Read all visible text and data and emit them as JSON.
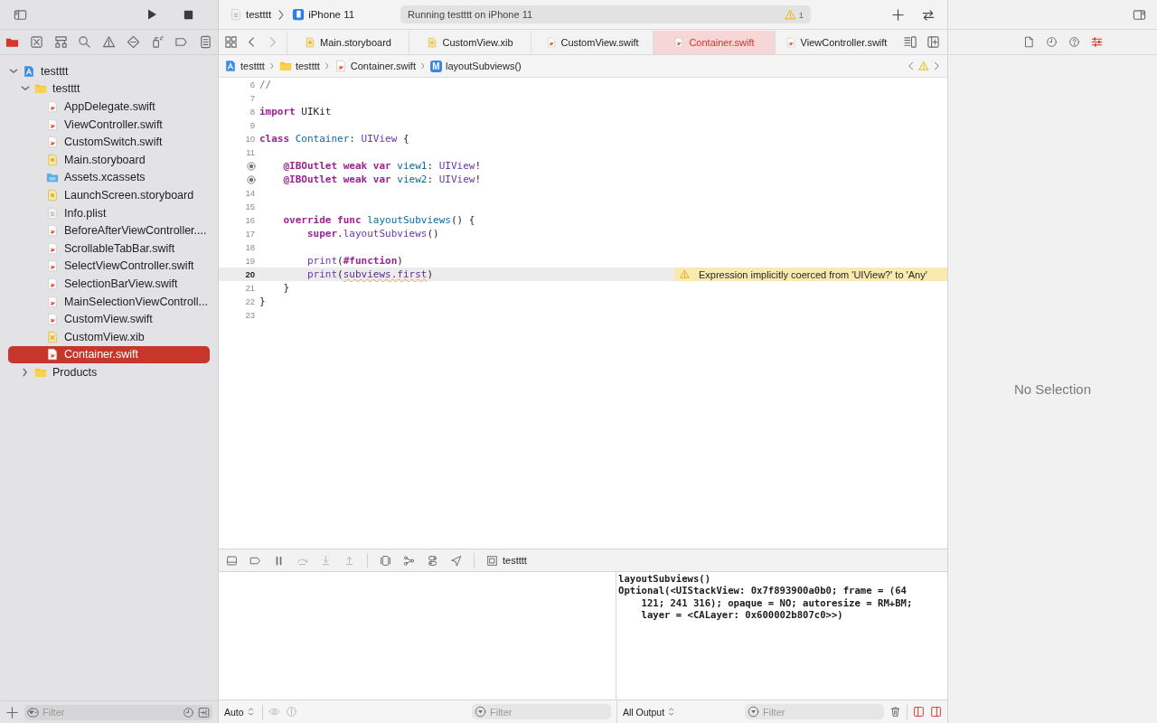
{
  "toolbar": {
    "scheme": "testttt",
    "device": "iPhone 11",
    "activity": "Running testttt on iPhone 11",
    "warning_count": "1"
  },
  "navigator": {
    "tree": [
      {
        "name": "testttt",
        "kind": "project",
        "expanded": true,
        "selected": false,
        "children": [
          {
            "name": "testttt",
            "kind": "folder",
            "expanded": true,
            "selected": false,
            "children": [
              {
                "name": "AppDelegate.swift",
                "kind": "swift",
                "selected": false
              },
              {
                "name": "ViewController.swift",
                "kind": "swift",
                "selected": false
              },
              {
                "name": "CustomSwitch.swift",
                "kind": "swift",
                "selected": false
              },
              {
                "name": "Main.storyboard",
                "kind": "storyboard",
                "selected": false
              },
              {
                "name": "Assets.xcassets",
                "kind": "assets",
                "selected": false
              },
              {
                "name": "LaunchScreen.storyboard",
                "kind": "storyboard",
                "selected": false
              },
              {
                "name": "Info.plist",
                "kind": "plist",
                "selected": false
              },
              {
                "name": "BeforeAfterViewController....",
                "kind": "swift",
                "selected": false
              },
              {
                "name": "ScrollableTabBar.swift",
                "kind": "swift",
                "selected": false
              },
              {
                "name": "SelectViewController.swift",
                "kind": "swift",
                "selected": false
              },
              {
                "name": "SelectionBarView.swift",
                "kind": "swift",
                "selected": false
              },
              {
                "name": "MainSelectionViewControll...",
                "kind": "swift",
                "selected": false
              },
              {
                "name": "CustomView.swift",
                "kind": "swift",
                "selected": false
              },
              {
                "name": "CustomView.xib",
                "kind": "xib",
                "selected": false
              },
              {
                "name": "Container.swift",
                "kind": "swift",
                "selected": true
              }
            ]
          },
          {
            "name": "Products",
            "kind": "folder",
            "expanded": false,
            "selected": false
          }
        ]
      }
    ],
    "filter": {
      "placeholder": "Filter"
    }
  },
  "tabs": [
    {
      "label": "Main.storyboard",
      "kind": "storyboard",
      "selected": false
    },
    {
      "label": "CustomView.xib",
      "kind": "xib",
      "selected": false
    },
    {
      "label": "CustomView.swift",
      "kind": "swift",
      "selected": false
    },
    {
      "label": "Container.swift",
      "kind": "swift",
      "selected": true
    },
    {
      "label": "ViewController.swift",
      "kind": "swift",
      "selected": false
    }
  ],
  "breadcrumb": [
    {
      "label": "testttt",
      "kind": "project"
    },
    {
      "label": "testttt",
      "kind": "folder"
    },
    {
      "label": "Container.swift",
      "kind": "swift"
    },
    {
      "label": "layoutSubviews()",
      "kind": "method",
      "badge": "M"
    }
  ],
  "editor": {
    "lines": [
      {
        "number": "6",
        "selected": false,
        "connected": false,
        "tokens": [
          {
            "text": "//",
            "kind": "comment"
          }
        ]
      },
      {
        "number": "7",
        "selected": false,
        "connected": false
      },
      {
        "number": "8",
        "selected": false,
        "connected": false,
        "tokens": [
          {
            "text": "import",
            "kind": "keyword"
          },
          {
            "text": " UIKit",
            "kind": "plain"
          }
        ]
      },
      {
        "number": "9",
        "selected": false,
        "connected": false
      },
      {
        "number": "10",
        "selected": false,
        "connected": false,
        "tokens": [
          {
            "text": "class",
            "kind": "keyword"
          },
          {
            "text": " Container",
            "kind": "declaration"
          },
          {
            "text": ": ",
            "kind": "plain"
          },
          {
            "text": "UIView",
            "kind": "type"
          },
          {
            "text": " {",
            "kind": "plain"
          }
        ]
      },
      {
        "number": "11",
        "selected": false,
        "connected": false
      },
      {
        "selected": false,
        "connected": true,
        "tokens": [
          {
            "text": "    @IBOutlet weak var ",
            "kind": "keyword"
          },
          {
            "text": "view1",
            "kind": "declaration"
          },
          {
            "text": ": ",
            "kind": "plain"
          },
          {
            "text": "UIView",
            "kind": "type"
          },
          {
            "text": "!",
            "kind": "plain"
          }
        ]
      },
      {
        "selected": false,
        "connected": true,
        "tokens": [
          {
            "text": "    @IBOutlet weak var ",
            "kind": "keyword"
          },
          {
            "text": "view2",
            "kind": "declaration"
          },
          {
            "text": ": ",
            "kind": "plain"
          },
          {
            "text": "UIView",
            "kind": "type"
          },
          {
            "text": "!",
            "kind": "plain"
          }
        ]
      },
      {
        "number": "14",
        "selected": false,
        "connected": false
      },
      {
        "number": "15",
        "selected": false,
        "connected": false
      },
      {
        "number": "16",
        "selected": false,
        "connected": false,
        "tokens": [
          {
            "text": "    override func ",
            "kind": "keyword"
          },
          {
            "text": "layoutSubviews",
            "kind": "declaration"
          },
          {
            "text": "() {",
            "kind": "plain"
          }
        ]
      },
      {
        "number": "17",
        "selected": false,
        "connected": false,
        "tokens": [
          {
            "text": "        super",
            "kind": "keyword"
          },
          {
            "text": ".",
            "kind": "plain"
          },
          {
            "text": "layoutSubviews",
            "kind": "call"
          },
          {
            "text": "()",
            "kind": "plain"
          }
        ]
      },
      {
        "number": "18",
        "selected": false,
        "connected": false
      },
      {
        "number": "19",
        "selected": false,
        "connected": false,
        "tokens": [
          {
            "text": "        print",
            "kind": "call"
          },
          {
            "text": "(",
            "kind": "plain"
          },
          {
            "text": "#function",
            "kind": "keyword"
          },
          {
            "text": ")",
            "kind": "plain"
          }
        ]
      },
      {
        "number": "20",
        "selected": true,
        "connected": false,
        "tokens": [
          {
            "text": "        print",
            "kind": "call"
          },
          {
            "text": "(",
            "kind": "plain"
          },
          {
            "text": "subviews.first",
            "kind": "warning"
          },
          {
            "text": ")",
            "kind": "plain"
          }
        ],
        "annotation": "Expression implicitly coerced from 'UIView?' to 'Any'"
      },
      {
        "number": "21",
        "selected": false,
        "connected": false,
        "tokens": [
          {
            "text": "    }",
            "kind": "plain"
          }
        ]
      },
      {
        "number": "22",
        "selected": false,
        "connected": false,
        "tokens": [
          {
            "text": "}",
            "kind": "plain"
          }
        ]
      },
      {
        "number": "23",
        "selected": false,
        "connected": false
      }
    ]
  },
  "debug_bar": {
    "process": "testttt"
  },
  "variables": {
    "scope": "Auto",
    "filter": {
      "placeholder": "Filter"
    }
  },
  "console": {
    "output": [
      "layoutSubviews()",
      "Optional(<UIStackView: 0x7f893900a0b0; frame = (64",
      "    121; 241 316); opaque = NO; autoresize = RM+BM;",
      "    layer = <CALayer: 0x600002b807c0>>)"
    ],
    "scope": "All Output",
    "filter": {
      "placeholder": "Filter"
    }
  },
  "inspector": {
    "message": "No Selection"
  }
}
